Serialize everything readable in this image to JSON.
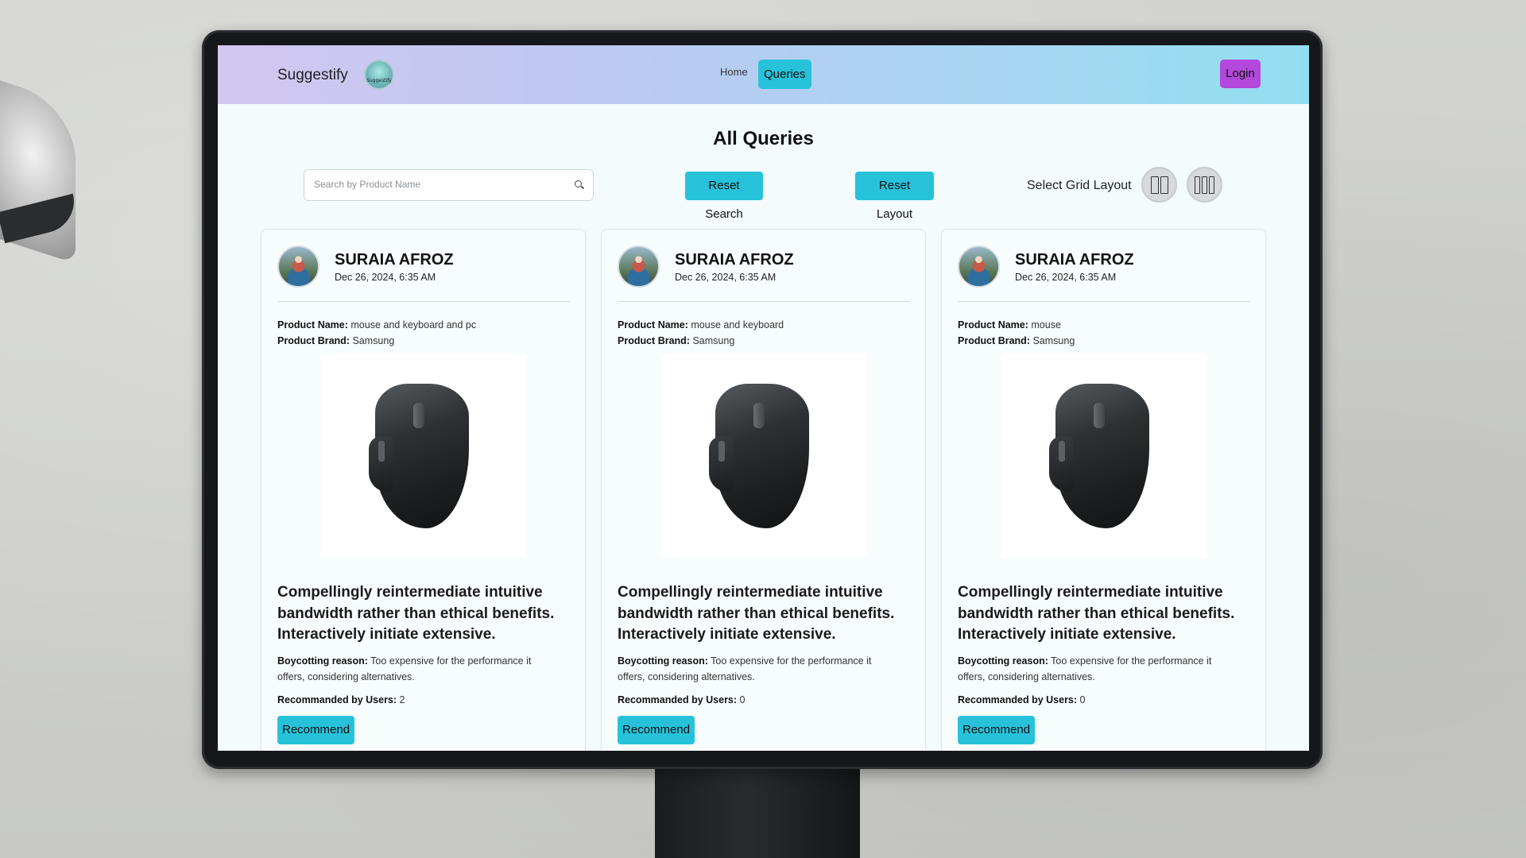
{
  "navbar": {
    "brand": "Suggestify",
    "logo_text": "Suggestify",
    "links": [
      {
        "label": "Home"
      },
      {
        "label": "Queries"
      }
    ],
    "login_label": "Login"
  },
  "page": {
    "title": "All Queries"
  },
  "controls": {
    "search_placeholder": "Search by Product Name",
    "search_value": "",
    "reset_search_label": "Reset Search",
    "reset_layout_label": "Reset Layout",
    "grid_label": "Select Grid Layout",
    "grid_options": [
      "two-column-grid-icon",
      "three-column-grid-icon"
    ]
  },
  "cards": [
    {
      "user_name": "SURAIA AFROZ",
      "date": "Dec 26, 2024, 6:35 AM",
      "product_name_label": "Product Name:",
      "product_name": "mouse and keyboard and pc",
      "product_brand_label": "Product Brand:",
      "product_brand": "Samsung",
      "title": "Compellingly reintermediate intuitive bandwidth rather than ethical benefits. Interactively initiate extensive.",
      "reason_label": "Boycotting reason:",
      "reason": "Too expensive for the performance it offers, considering alternatives.",
      "rec_label": "Recommanded by Users:",
      "rec_count": "2",
      "button": "Recommend"
    },
    {
      "user_name": "SURAIA AFROZ",
      "date": "Dec 26, 2024, 6:35 AM",
      "product_name_label": "Product Name:",
      "product_name": "mouse and keyboard",
      "product_brand_label": "Product Brand:",
      "product_brand": "Samsung",
      "title": "Compellingly reintermediate intuitive bandwidth rather than ethical benefits. Interactively initiate extensive.",
      "reason_label": "Boycotting reason:",
      "reason": "Too expensive for the performance it offers, considering alternatives.",
      "rec_label": "Recommanded by Users:",
      "rec_count": "0",
      "button": "Recommend"
    },
    {
      "user_name": "SURAIA AFROZ",
      "date": "Dec 26, 2024, 6:35 AM",
      "product_name_label": "Product Name:",
      "product_name": "mouse",
      "product_brand_label": "Product Brand:",
      "product_brand": "Samsung",
      "title": "Compellingly reintermediate intuitive bandwidth rather than ethical benefits. Interactively initiate extensive.",
      "reason_label": "Boycotting reason:",
      "reason": "Too expensive for the performance it offers, considering alternatives.",
      "rec_label": "Recommanded by Users:",
      "rec_count": "0",
      "button": "Recommend"
    }
  ],
  "colors": {
    "accent_cyan": "#27c2da",
    "login_purple": "#b448dc",
    "navbar_gradient_start": "#d3c7f1",
    "navbar_gradient_end": "#92def0"
  }
}
